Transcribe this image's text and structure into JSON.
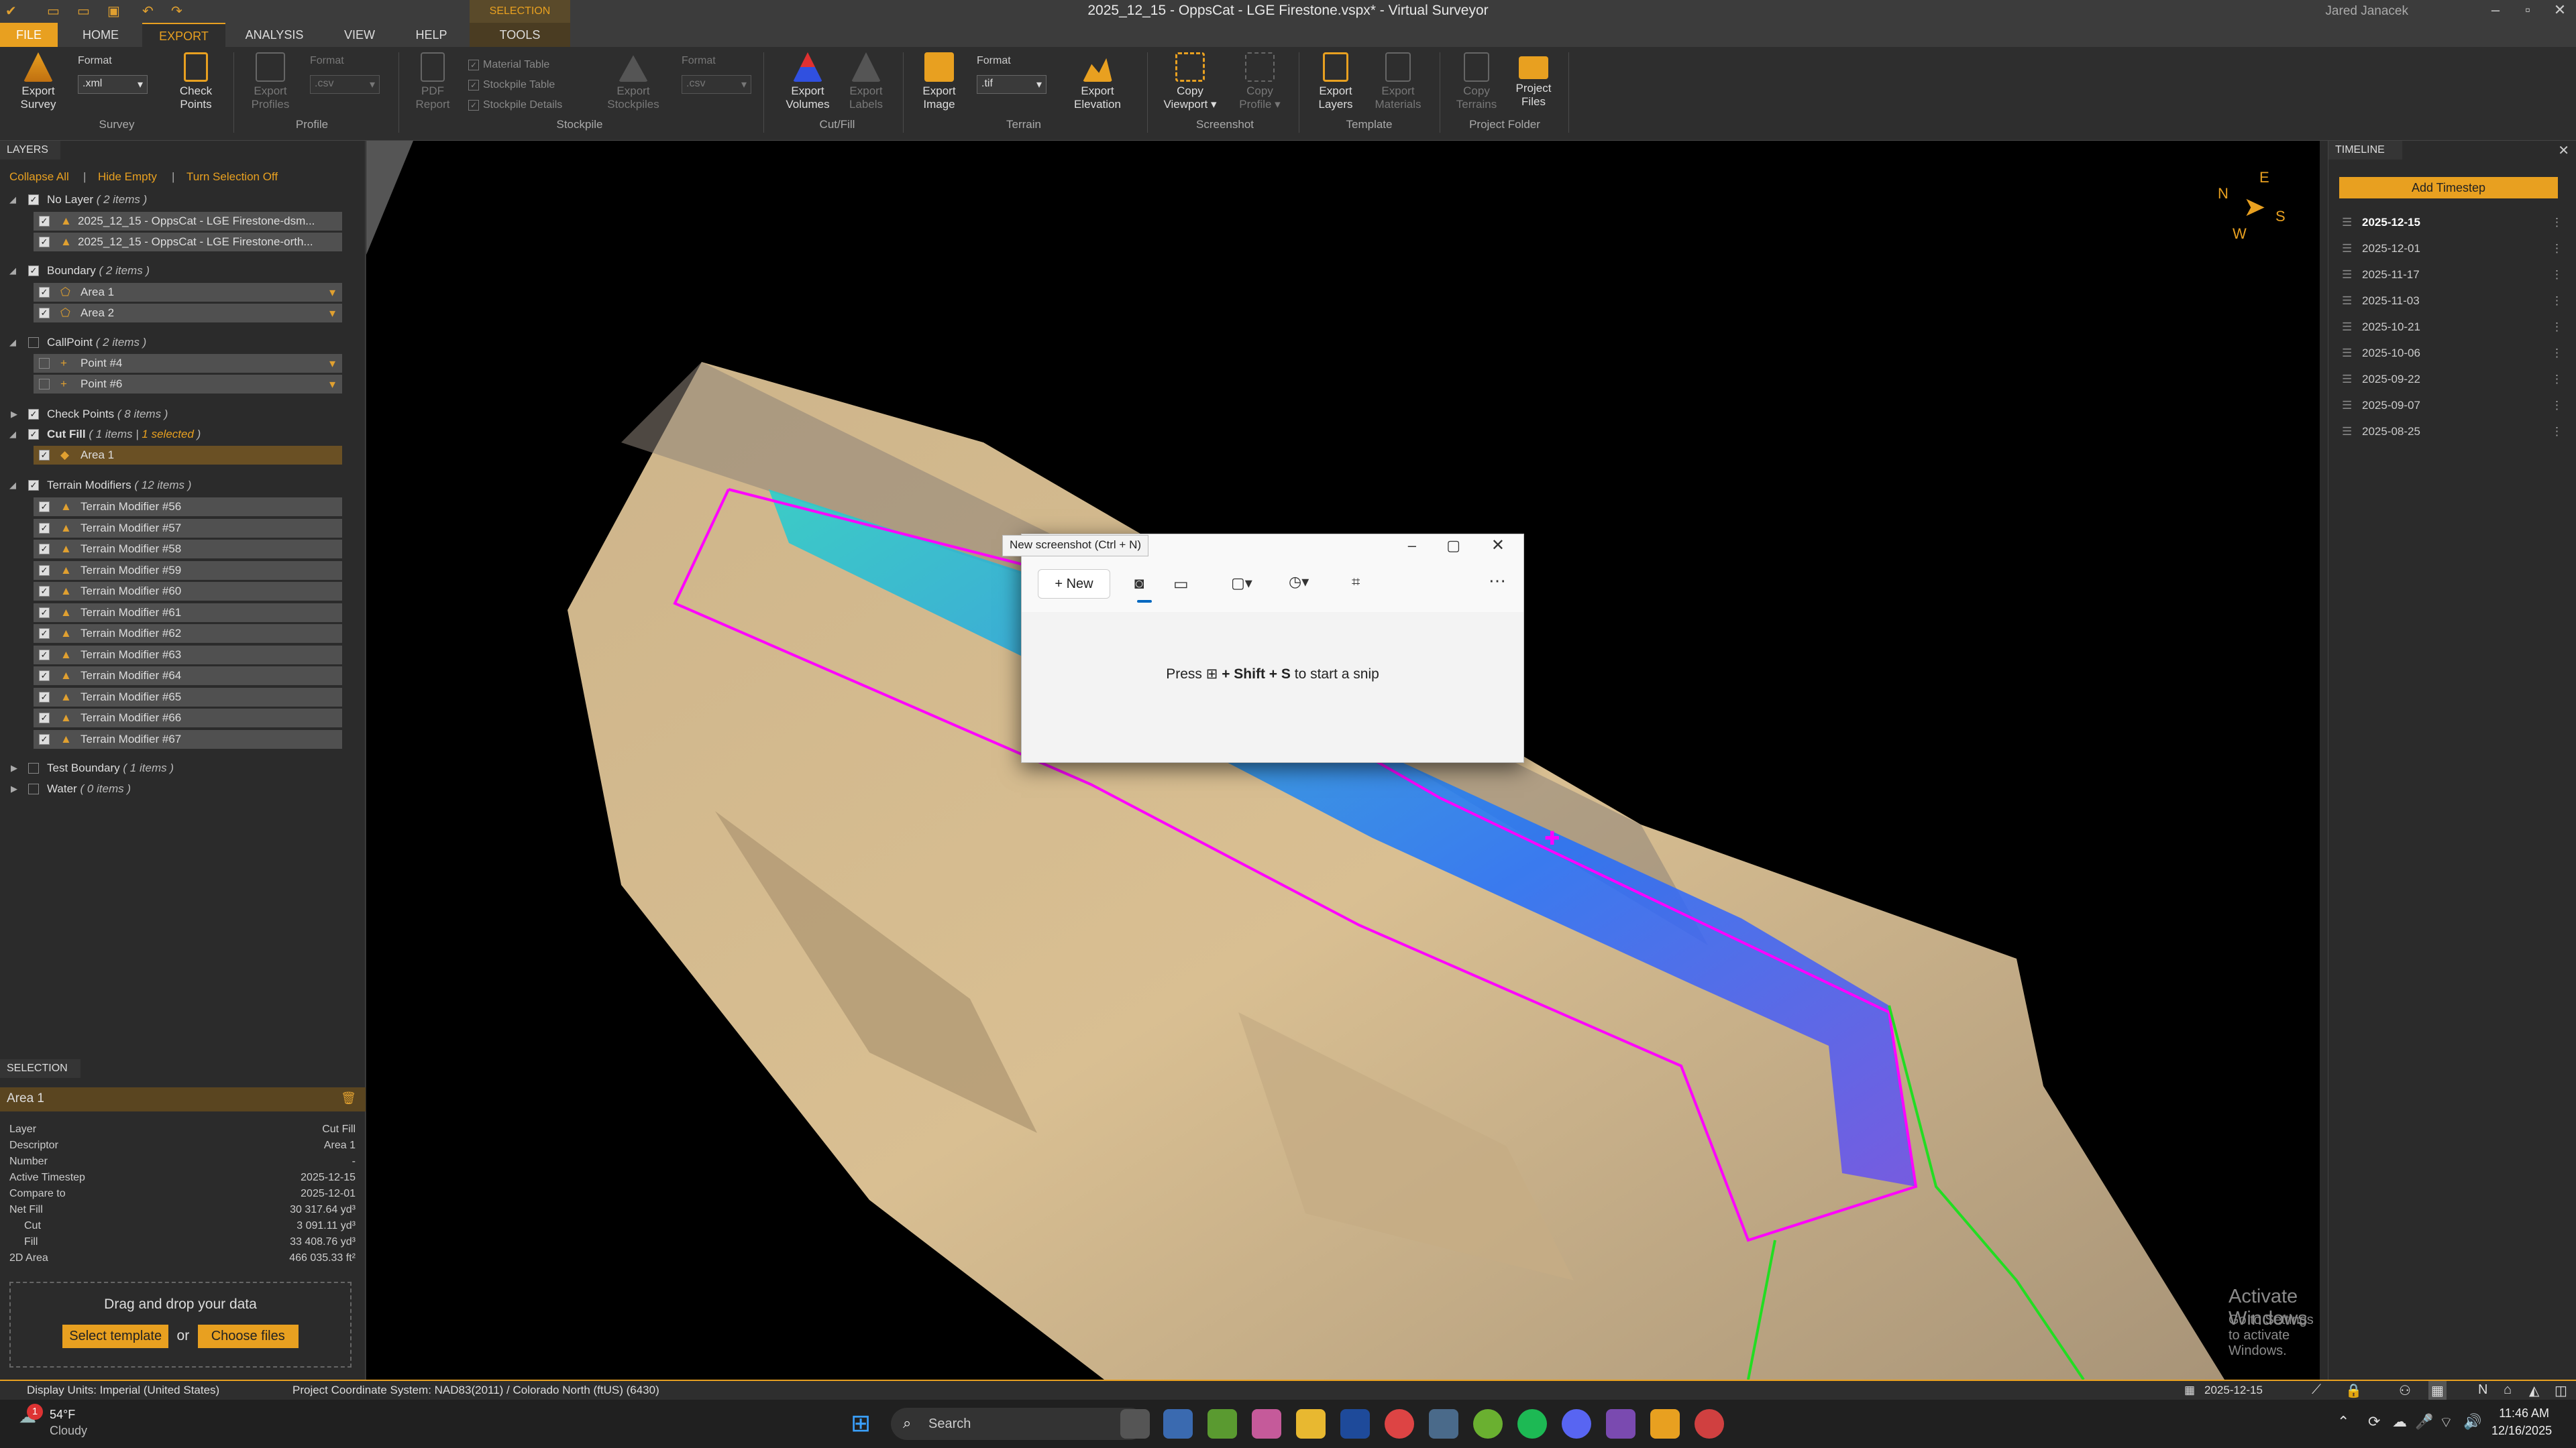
{
  "window": {
    "title": "2025_12_15 - OppsCat - LGE Firestone.vspx* - Virtual Surveyor",
    "user": "Jared Janacek"
  },
  "tabs": [
    "FILE",
    "HOME",
    "EXPORT",
    "ANALYSIS",
    "VIEW",
    "HELP",
    "TOOLS"
  ],
  "selection_tab_label": "SELECTION",
  "ribbon": {
    "format_label": "Format",
    "survey": {
      "export_survey": "Export Survey",
      "format_value": ".xml",
      "check_points": "Check Points",
      "group": "Survey"
    },
    "profile": {
      "export_profiles": "Export Profiles",
      "format_value": ".csv",
      "group": "Profile"
    },
    "stockpile": {
      "pdf_report": "PDF Report",
      "material_table": "Material Table",
      "stockpile_table": "Stockpile Table",
      "stockpile_details": "Stockpile Details",
      "export_stockpiles": "Export Stockpiles",
      "format_value": ".csv",
      "group": "Stockpile"
    },
    "cutfill": {
      "export_volumes": "Export Volumes",
      "export_labels": "Export Labels",
      "group": "Cut/Fill"
    },
    "terrain": {
      "export_image": "Export Image",
      "format_value": ".tif",
      "export_elevation": "Export Elevation",
      "group": "Terrain"
    },
    "screenshot": {
      "copy_viewport": "Copy Viewport",
      "copy_profile": "Copy Profile",
      "group": "Screenshot"
    },
    "template": {
      "export_layers": "Export Layers",
      "export_materials": "Export Materials",
      "group": "Template"
    },
    "project_folder": {
      "copy_terrains": "Copy Terrains",
      "project_files": "Project Files",
      "group": "Project Folder"
    }
  },
  "layers": {
    "header": "LAYERS",
    "actions": {
      "collapse_all": "Collapse All",
      "hide_empty": "Hide Empty",
      "turn_selection_off": "Turn Selection Off"
    },
    "groups": [
      {
        "name": "No Layer",
        "count": "( 2 items )",
        "children": [
          "2025_12_15 - OppsCat - LGE Firestone-dsm...",
          "2025_12_15 - OppsCat - LGE Firestone-orth..."
        ]
      },
      {
        "name": "Boundary",
        "count": "( 2 items )",
        "children": [
          "Area 1",
          "Area 2"
        ]
      },
      {
        "name": "CallPoint",
        "count": "( 2 items )",
        "children": [
          "Point #4",
          "Point #6"
        ]
      },
      {
        "name": "Check Points",
        "count": "( 8 items )"
      },
      {
        "name": "Cut Fill",
        "count": "( 1 items |",
        "selected": "1 selected",
        "count_end": ")",
        "children": [
          "Area 1"
        ]
      },
      {
        "name": "Terrain Modifiers",
        "count": "( 12 items )",
        "children": [
          "Terrain Modifier #56",
          "Terrain Modifier #57",
          "Terrain Modifier #58",
          "Terrain Modifier #59",
          "Terrain Modifier #60",
          "Terrain Modifier #61",
          "Terrain Modifier #62",
          "Terrain Modifier #63",
          "Terrain Modifier #64",
          "Terrain Modifier #65",
          "Terrain Modifier #66",
          "Terrain Modifier #67"
        ]
      },
      {
        "name": "Test Boundary",
        "count": "( 1 items )"
      },
      {
        "name": "Water",
        "count": "( 0 items )"
      }
    ]
  },
  "selection": {
    "header": "SELECTION",
    "item_title": "Area 1",
    "properties": [
      {
        "label": "Layer",
        "value": "Cut Fill"
      },
      {
        "label": "Descriptor",
        "value": "Area 1"
      },
      {
        "label": "Number",
        "value": "-"
      },
      {
        "label": "Active Timestep",
        "value": "2025-12-15"
      },
      {
        "label": "Compare to",
        "value": "2025-12-01"
      },
      {
        "label": "Net Fill",
        "value": "30 317.64 yd³"
      },
      {
        "label": "Cut",
        "value": "3 091.11 yd³"
      },
      {
        "label": "Fill",
        "value": "33 408.76 yd³"
      },
      {
        "label": "2D Area",
        "value": "466 035.33 ft²"
      }
    ],
    "drop_text": "Drag and drop your data",
    "select_template": "Select template",
    "or": "or",
    "choose_files": "Choose files"
  },
  "compass": {
    "n": "N",
    "e": "E",
    "s": "S",
    "w": "W"
  },
  "snip": {
    "tooltip": "New screenshot (Ctrl + N)",
    "new_label": "New",
    "message_pre": "Press",
    "message_keys": "+ Shift + S",
    "message_post": "to start a snip"
  },
  "watermark": {
    "line1": "Activate Windows",
    "line2": "Go to Settings to activate Windows."
  },
  "timeline": {
    "header": "TIMELINE",
    "add_button": "Add Timestep",
    "dates": [
      "2025-12-15",
      "2025-12-01",
      "2025-11-17",
      "2025-11-03",
      "2025-10-21",
      "2025-10-06",
      "2025-09-22",
      "2025-09-07",
      "2025-08-25"
    ]
  },
  "status": {
    "display_units": "Display Units:  Imperial (United States)",
    "coord_system": "Project Coordinate System:  NAD83(2011) / Colorado North (ftUS) (6430)",
    "timestep": "2025-12-15"
  },
  "taskbar": {
    "weather_temp": "54°F",
    "weather_desc": "Cloudy",
    "search": "Search",
    "time": "11:46 AM",
    "date": "12/16/2025",
    "badge": "1"
  },
  "colors": {
    "accent": "#e8a020",
    "boundary": "#ff00ff",
    "boundary2": "#22dd22",
    "cut": "#1e6fff",
    "fill": "#22d0d0"
  }
}
